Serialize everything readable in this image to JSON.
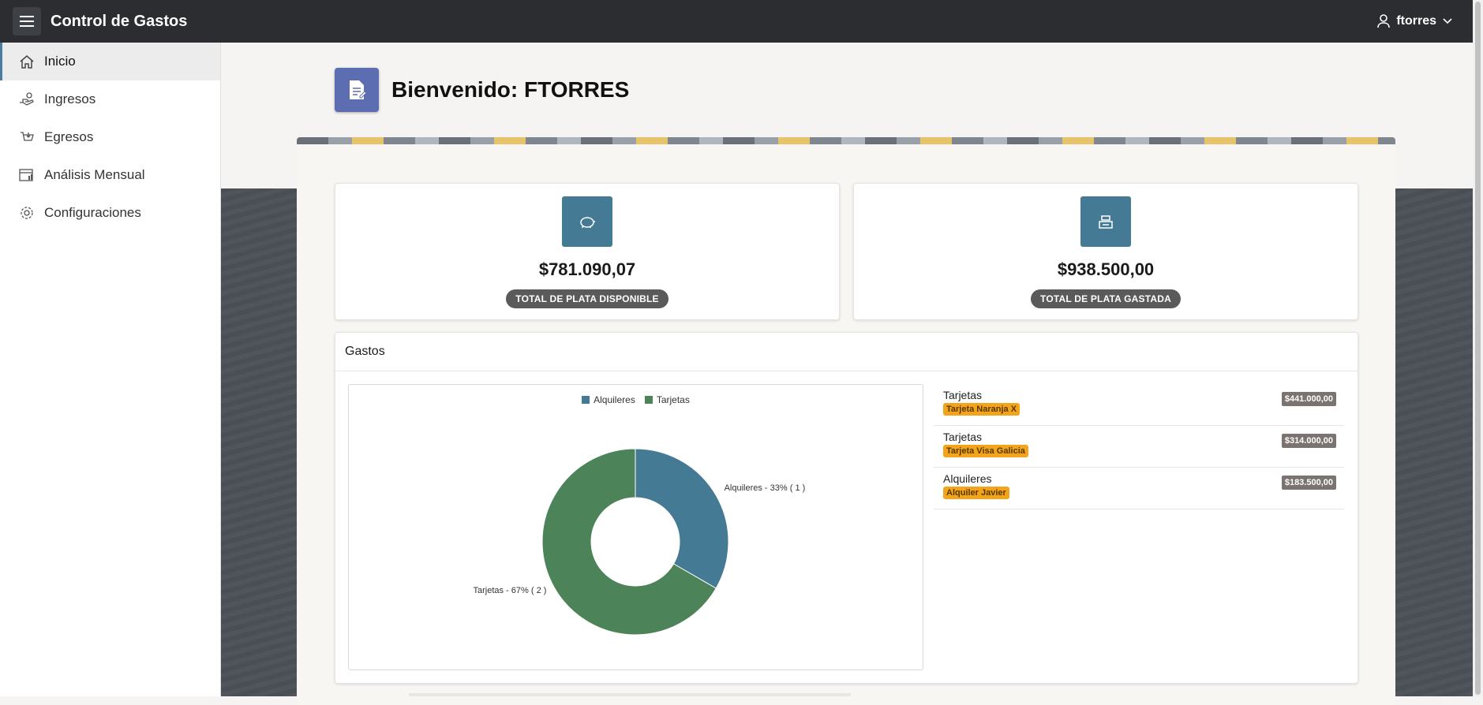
{
  "app": {
    "title": "Control de Gastos"
  },
  "user": {
    "name": "ftorres"
  },
  "sidebar": {
    "items": [
      {
        "label": "Inicio",
        "icon": "home-icon",
        "active": true
      },
      {
        "label": "Ingresos",
        "icon": "hand-money-icon",
        "active": false
      },
      {
        "label": "Egresos",
        "icon": "cart-out-icon",
        "active": false
      },
      {
        "label": "Análisis Mensual",
        "icon": "calendar-chart-icon",
        "active": false
      },
      {
        "label": "Configuraciones",
        "icon": "gear-icon",
        "active": false
      }
    ]
  },
  "page": {
    "title": "Bienvenido: FTORRES",
    "icon": "document-edit-icon"
  },
  "kpis": [
    {
      "value": "$781.090,07",
      "label": "TOTAL DE PLATA DISPONIBLE",
      "icon": "piggy-bank-icon"
    },
    {
      "value": "$938.500,00",
      "label": "TOTAL DE PLATA GASTADA",
      "icon": "cash-register-icon"
    }
  ],
  "gastos": {
    "title": "Gastos",
    "list": [
      {
        "category": "Tarjetas",
        "detail": "Tarjeta Naranja X",
        "amount": "$441.000,00"
      },
      {
        "category": "Tarjetas",
        "detail": "Tarjeta Visa Galicia",
        "amount": "$314.000,00"
      },
      {
        "category": "Alquileres",
        "detail": "Alquiler Javier",
        "amount": "$183.500,00"
      }
    ]
  },
  "chart_data": {
    "type": "pie",
    "categories": [
      "Alquileres",
      "Tarjetas"
    ],
    "values": [
      1,
      2
    ],
    "percents": [
      33,
      67
    ],
    "data_labels": [
      "Alquileres - 33% ( 1 )",
      "Tarjetas - 67% ( 2 )"
    ],
    "colors": [
      "#447a93",
      "#4c8359"
    ],
    "legend": [
      "Alquileres",
      "Tarjetas"
    ],
    "legend_position": "top"
  },
  "colors": {
    "topbar": "#2b2d30",
    "accent": "#447a93",
    "tag": "#f2a41a",
    "amount_badge": "#7a7370"
  }
}
